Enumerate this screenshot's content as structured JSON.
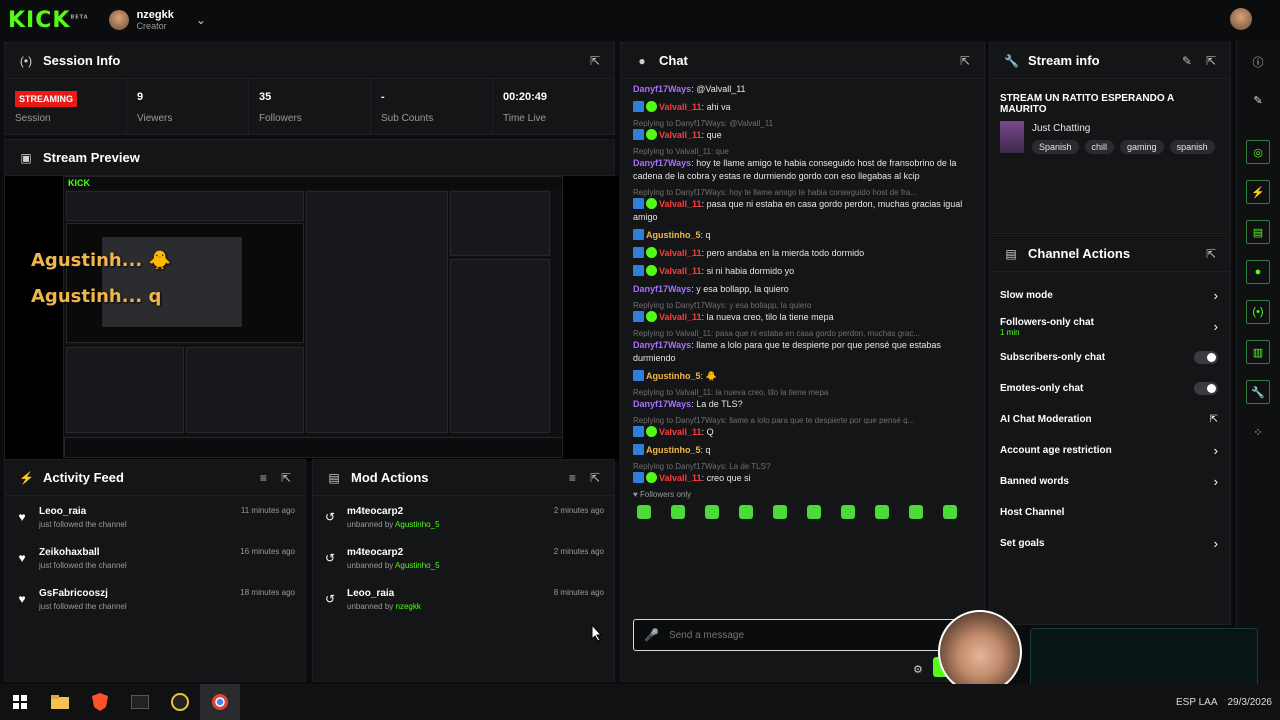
{
  "topbar": {
    "logo": "KICK",
    "logo_beta": "BETA",
    "username": "nzegkk",
    "role": "Creator"
  },
  "session": {
    "title": "Session Info",
    "badge": "STREAMING",
    "badge_label": "Session",
    "stats": [
      {
        "value": "9",
        "label": "Viewers"
      },
      {
        "value": "35",
        "label": "Followers"
      },
      {
        "value": "-",
        "label": "Sub Counts"
      },
      {
        "value": "00:20:49",
        "label": "Time Live"
      }
    ]
  },
  "preview": {
    "title": "Stream Preview",
    "overlay_lines": [
      "Agustinh... 🐥",
      "Agustinh... q"
    ]
  },
  "activity": {
    "title": "Activity Feed",
    "items": [
      {
        "name": "Leoo_raia",
        "desc": "just followed the channel",
        "time": "11 minutes ago"
      },
      {
        "name": "Zeikohaxball",
        "desc": "just followed the channel",
        "time": "16 minutes ago"
      },
      {
        "name": "GsFabricooszj",
        "desc": "just followed the channel",
        "time": "18 minutes ago"
      }
    ]
  },
  "mod": {
    "title": "Mod Actions",
    "items": [
      {
        "name": "m4teocarp2",
        "desc": "unbanned by",
        "by": "Agustinho_5",
        "time": "2 minutes ago"
      },
      {
        "name": "m4teocarp2",
        "desc": "unbanned by",
        "by": "Agustinho_5",
        "time": "2 minutes ago"
      },
      {
        "name": "Leoo_raia",
        "desc": "unbanned by",
        "by": "nzegkk",
        "time": "8 minutes ago"
      }
    ]
  },
  "chat": {
    "title": "Chat",
    "followers_only": "Followers only",
    "placeholder": "Send a message",
    "messages": [
      {
        "reply": "",
        "user": "Danyf17Ways",
        "color": "purple",
        "badges": false,
        "text": " @Valvall_11"
      },
      {
        "reply": "",
        "user": "Valvall_11",
        "color": "red",
        "badges": true,
        "text": " ahi va"
      },
      {
        "reply": "Replying to Danyf17Ways: @Valvall_11",
        "user": "Valvall_11",
        "color": "red",
        "badges": true,
        "text": " que"
      },
      {
        "reply": "Replying to Valvall_11: que",
        "user": "Danyf17Ways",
        "color": "purple",
        "badges": false,
        "text": " hoy te llame amigo te habia conseguido host de fransobrino de la cadena de la cobra y estas re durmiendo gordo con eso llegabas al kcip"
      },
      {
        "reply": "Replying to Danyf17Ways: hoy te llame amigo te habia conseguido host de fra...",
        "user": "Valvall_11",
        "color": "red",
        "badges": true,
        "text": " pasa que ni estaba en casa gordo perdon, muchas gracias igual amigo"
      },
      {
        "reply": "",
        "user": "Agustinho_5",
        "color": "gold",
        "badges": "blue",
        "text": " q"
      },
      {
        "reply": "",
        "user": "Valvall_11",
        "color": "red",
        "badges": true,
        "text": " pero andaba en la mierda todo dormido"
      },
      {
        "reply": "",
        "user": "Valvall_11",
        "color": "red",
        "badges": true,
        "text": " si ni habia dormido yo"
      },
      {
        "reply": "",
        "user": "Danyf17Ways",
        "color": "purple",
        "badges": false,
        "text": " y esa bollapp, la quiero"
      },
      {
        "reply": "Replying to Danyf17Ways: y esa bollapp, la quiero",
        "user": "Valvall_11",
        "color": "red",
        "badges": true,
        "text": " la nueva creo, tilo la tiene mepa"
      },
      {
        "reply": "Replying to Valvall_11: pasa que ni estaba en casa gordo perdon, muchas grac...",
        "user": "Danyf17Ways",
        "color": "purple",
        "badges": false,
        "text": " llame a lolo para que te despierte por que pensé que estabas durmiendo"
      },
      {
        "reply": "",
        "user": "Agustinho_5",
        "color": "gold",
        "badges": "blue",
        "text": " 🐥"
      },
      {
        "reply": "Replying to Valvall_11: la nueva creo, tilo la tiene mepa",
        "user": "Danyf17Ways",
        "color": "purple",
        "badges": false,
        "text": " La de TLS?"
      },
      {
        "reply": "Replying to Danyf17Ways: llame a lolo para que te despierte por que pensé q...",
        "user": "Valvall_11",
        "color": "red",
        "badges": true,
        "text": " Q"
      },
      {
        "reply": "",
        "user": "Agustinho_5",
        "color": "gold",
        "badges": "blue",
        "text": " q"
      },
      {
        "reply": "Replying to Danyf17Ways: La de TLS?",
        "user": "Valvall_11",
        "color": "red",
        "badges": true,
        "text": " creo que si"
      }
    ]
  },
  "stream_info": {
    "title": "Stream info",
    "stream_title": "STREAM UN RATITO ESPERANDO A MAURITO",
    "category": "Just Chatting",
    "tags": [
      "Spanish",
      "chill",
      "gaming",
      "spanish"
    ]
  },
  "channel_actions": {
    "title": "Channel Actions",
    "items": [
      {
        "label": "Slow mode",
        "sub": "",
        "kind": "arrow"
      },
      {
        "label": "Followers-only chat",
        "sub": "1 min",
        "kind": "arrow"
      },
      {
        "label": "Subscribers-only chat",
        "sub": "",
        "kind": "toggle"
      },
      {
        "label": "Emotes-only chat",
        "sub": "",
        "kind": "toggle"
      },
      {
        "label": "AI Chat Moderation",
        "sub": "",
        "kind": "external"
      },
      {
        "label": "Account age restriction",
        "sub": "",
        "kind": "arrow"
      },
      {
        "label": "Banned words",
        "sub": "",
        "kind": "arrow"
      },
      {
        "label": "Host Channel",
        "sub": "",
        "kind": "none"
      },
      {
        "label": "Set goals",
        "sub": "",
        "kind": "arrow"
      }
    ]
  },
  "tray": {
    "lang": "ESP LAA",
    "date": "29/3/2026"
  },
  "colors": {
    "accent": "#53fc18",
    "streaming": "#e91916",
    "panel": "#141517"
  }
}
